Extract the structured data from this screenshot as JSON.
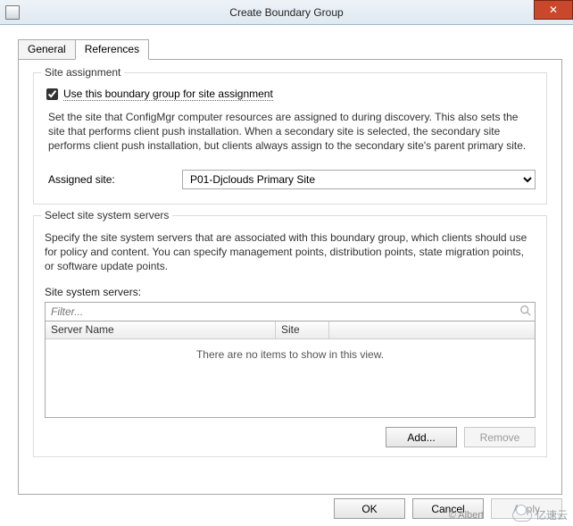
{
  "window": {
    "title": "Create Boundary Group",
    "close_glyph": "✕"
  },
  "tabs": {
    "general": "General",
    "references": "References"
  },
  "site_assignment": {
    "legend": "Site assignment",
    "checkbox_label": "Use this boundary group for site assignment",
    "checked": true,
    "description": "Set the site that ConfigMgr computer resources are assigned to during discovery. This also sets the site that performs client push installation. When a secondary site is selected, the secondary site performs client push installation, but clients always assign to the secondary site's parent primary site.",
    "assigned_site_label": "Assigned site:",
    "assigned_site_value": "P01-Djclouds Primary Site"
  },
  "site_systems": {
    "legend": "Select site system servers",
    "description": "Specify the site system servers that are associated with this boundary group, which clients should use for policy and content. You can specify management points, distribution points, state migration points, or software update points.",
    "list_label": "Site system servers:",
    "filter_placeholder": "Filter...",
    "col_server": "Server Name",
    "col_site": "Site",
    "empty_text": "There are no items to show in this view.",
    "add_label": "Add...",
    "remove_label": "Remove"
  },
  "buttons": {
    "ok": "OK",
    "cancel": "Cancel",
    "apply": "Apply"
  },
  "watermark": {
    "artist": "© Albert",
    "brand": "亿速云"
  }
}
